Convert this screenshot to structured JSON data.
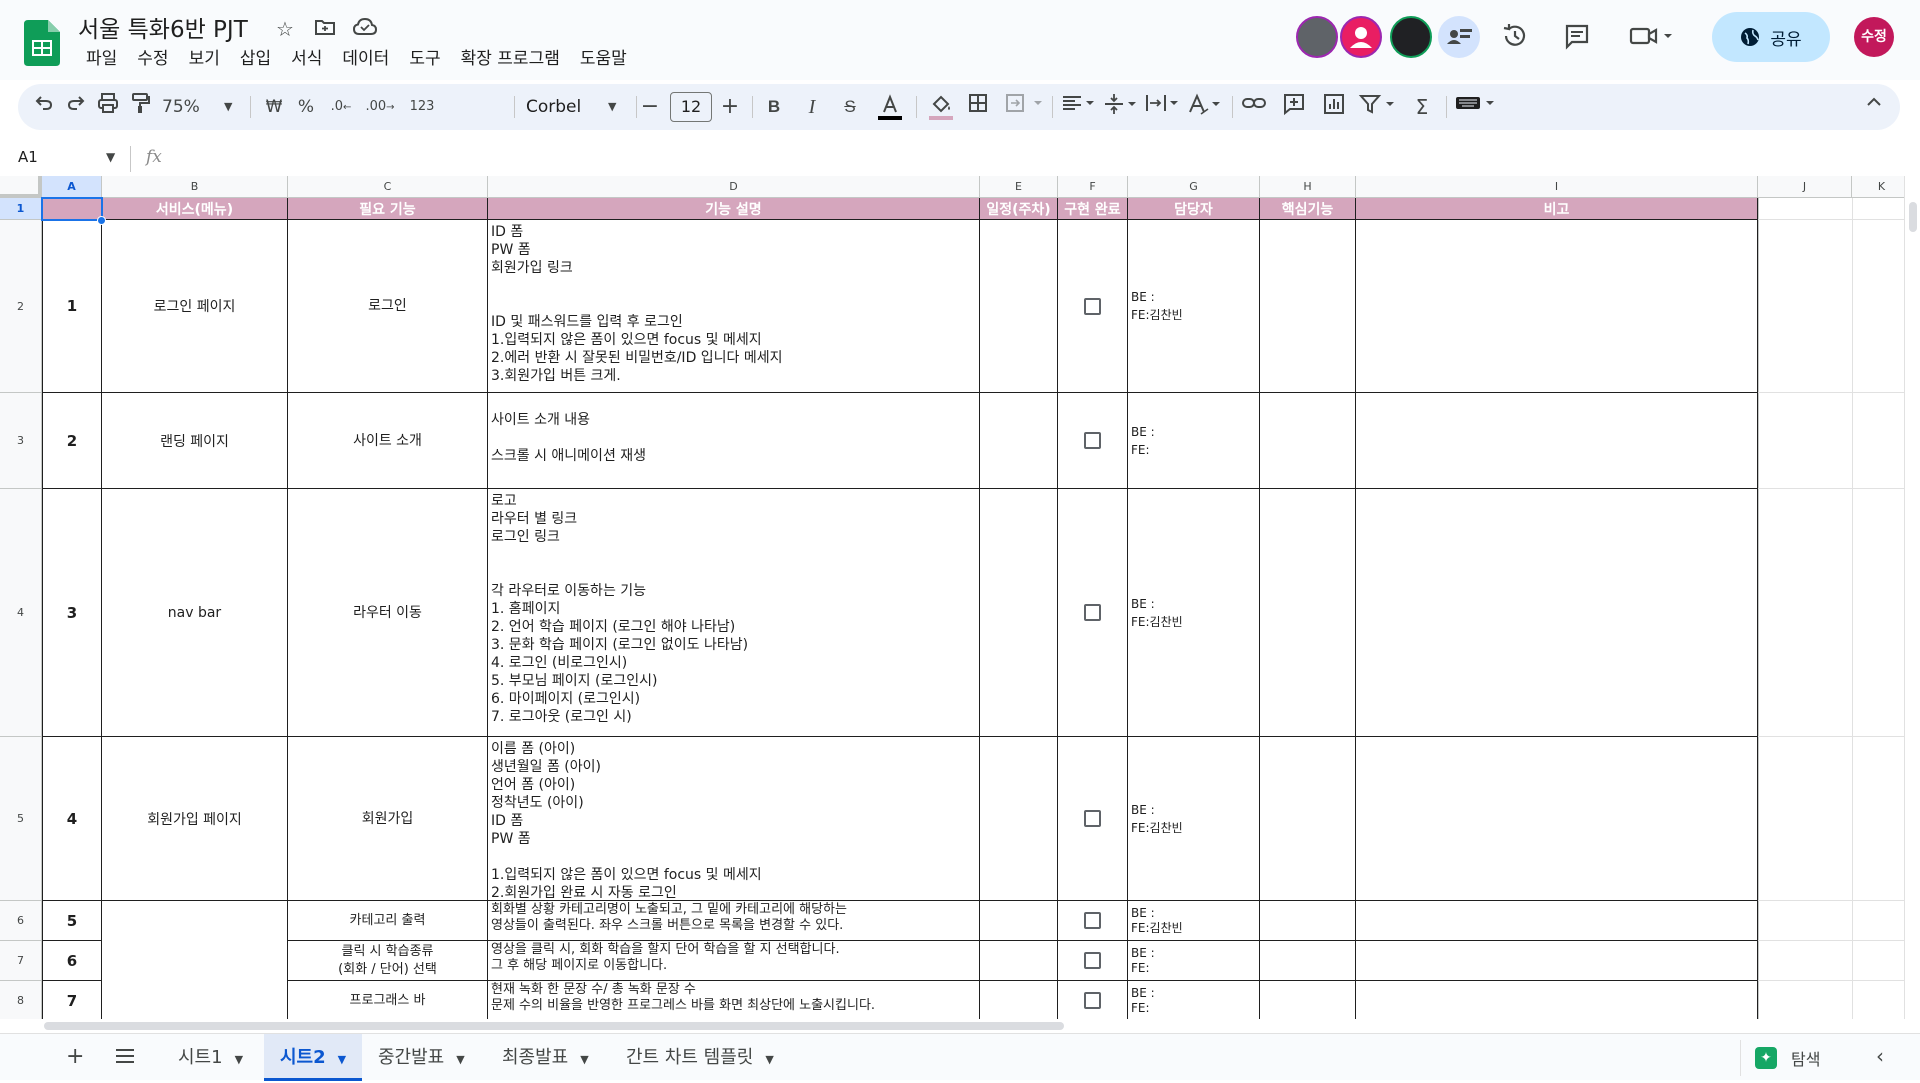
{
  "doc": {
    "title": "서울 특화6반 PJT",
    "menu": [
      "파일",
      "수정",
      "보기",
      "삽입",
      "서식",
      "데이터",
      "도구",
      "확장 프로그램",
      "도움말"
    ],
    "share_label": "공유",
    "user_initials": "수정",
    "brand_color": "#0f9d58"
  },
  "toolbar": {
    "zoom": "75%",
    "currency": "₩",
    "percent": "%",
    "dec_decrease": ".0",
    "dec_increase": ".00",
    "number_format": "123",
    "font": "Corbel",
    "font_size": "12"
  },
  "formula_bar": {
    "cell_ref": "A1",
    "fx": "fx",
    "value": ""
  },
  "columns": [
    "A",
    "B",
    "C",
    "D",
    "E",
    "F",
    "G",
    "H",
    "I",
    "J",
    "K"
  ],
  "rows": [
    "1",
    "2",
    "3",
    "4",
    "5",
    "6",
    "7",
    "8"
  ],
  "header_row": {
    "service": "서비스(메뉴)",
    "feature": "필요 기능",
    "description": "기능 설명",
    "schedule": "일정(주차)",
    "done": "구현 완료",
    "owner": "담당자",
    "core": "핵심기능",
    "note": "비고",
    "header_color": "#d5a6bd"
  },
  "table_rows": [
    {
      "num": "1",
      "service": "로그인 페이지",
      "feature": "로그인",
      "description": "ID 폼\nPW 폼\n회원가입 링크\n\n\nID 및 패스워드를 입력 후 로그인\n1.입력되지 않은 폼이 있으면 focus 및 메세지\n2.에러 반환 시 잘못된 비밀번호/ID 입니다 메세지\n3.회원가입 버튼 크게.",
      "owner": "BE :\nFE:김찬빈",
      "checked": false
    },
    {
      "num": "2",
      "service": "랜딩 페이지",
      "feature": "사이트 소개",
      "description": "사이트 소개 내용\n\n스크롤 시 애니메이션 재생",
      "owner": "BE :\nFE:",
      "checked": false
    },
    {
      "num": "3",
      "service": "nav bar",
      "feature": "라우터 이동",
      "description": "로고\n라우터 별 링크\n로그인 링크\n\n\n각 라우터로 이동하는 기능\n1. 홈페이지\n2. 언어 학습 페이지 (로그인 해야 나타남)\n3. 문화 학습 페이지 (로그인 없이도 나타남)\n4. 로그인 (비로그인시)\n5. 부모님 페이지 (로그인시)\n6. 마이페이지 (로그인시)\n7. 로그아웃 (로그인 시)",
      "owner": "BE :\nFE:김찬빈",
      "checked": false
    },
    {
      "num": "4",
      "service": "회원가입 페이지",
      "feature": "회원가입",
      "description": "이름 폼 (아이)\n생년월일 폼 (아이)\n언어 폼 (아이)\n정착년도 (아이)\nID 폼\nPW 폼\n\n1.입력되지 않은 폼이 있으면 focus 및 메세지\n2.회원가입 완료 시 자동 로그인",
      "owner": "BE :\nFE:김찬빈",
      "checked": false
    },
    {
      "num": "5",
      "service": "",
      "feature": "카테고리 출력",
      "description": "회화별 상황 카테고리명이 노출되고, 그 밑에 카테고리에 해당하는\n영상들이 출력된다. 좌우 스크롤 버튼으로 목록을 변경할 수 있다.",
      "owner": "BE :\nFE:김찬빈",
      "checked": false
    },
    {
      "num": "6",
      "service": "",
      "feature": "클릭 시 학습종류\n(회화 / 단어) 선택",
      "description": "영상을 클릭 시, 회화 학습을 할지 단어 학습을 할 지 선택합니다.\n그 후 해당 페이지로 이동합니다.",
      "owner": "BE :\nFE:",
      "checked": false
    },
    {
      "num": "7",
      "service": "",
      "feature": "프로그래스 바",
      "description": "현재 녹화 한 문장 수/ 총 녹화 문장 수\n문제 수의 비율을 반영한 프로그레스 바를 화면 최상단에 노출시킵니다.",
      "owner": "BE :\nFE:",
      "checked": false
    }
  ],
  "sheet_tabs": [
    {
      "label": "시트1",
      "active": false
    },
    {
      "label": "시트2",
      "active": true
    },
    {
      "label": "중간발표",
      "active": false
    },
    {
      "label": "최종발표",
      "active": false
    },
    {
      "label": "간트 차트 템플릿",
      "active": false
    }
  ],
  "explore_label": "탐색"
}
